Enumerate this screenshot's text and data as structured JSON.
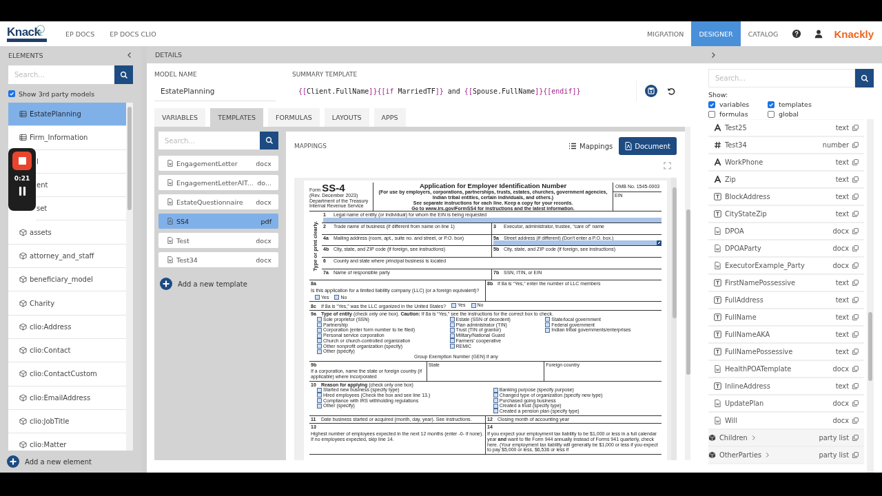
{
  "header": {
    "logo": "Knack",
    "nav_left": [
      {
        "label": "EP DOCS",
        "selected": false
      },
      {
        "label": "EP DOCS CLIO",
        "selected": false
      }
    ],
    "nav_right": [
      {
        "label": "MIGRATION",
        "selected": false
      },
      {
        "label": "DESIGNER",
        "selected": true
      },
      {
        "label": "CATALOG",
        "selected": false
      }
    ],
    "brand": "Knackly"
  },
  "elements": {
    "title": "ELEMENTS",
    "search": {
      "placeholder": "Search..."
    },
    "show_third_party": {
      "label": "Show 3rd party models",
      "checked": true
    },
    "items": [
      {
        "name": "EstatePlanning",
        "kind": "model",
        "selected": true
      },
      {
        "name": "Firm_Information",
        "kind": "model",
        "selected": false
      },
      {
        "name": "l",
        "kind": "covered",
        "selected": false
      },
      {
        "name": "ent",
        "kind": "covered",
        "selected": false
      },
      {
        "name": "set",
        "kind": "covered",
        "selected": false
      },
      {
        "name": "assets",
        "kind": "cube",
        "selected": false
      },
      {
        "name": "attorney_and_staff",
        "kind": "cube",
        "selected": false
      },
      {
        "name": "beneficiary_model",
        "kind": "cube",
        "selected": false
      },
      {
        "name": "Charity",
        "kind": "cube",
        "selected": false
      },
      {
        "name": "clio:Address",
        "kind": "cube",
        "selected": false
      },
      {
        "name": "clio:Contact",
        "kind": "cube",
        "selected": false
      },
      {
        "name": "clio:ContactCustom",
        "kind": "cube",
        "selected": false
      },
      {
        "name": "clio:EmailAddress",
        "kind": "cube",
        "selected": false
      },
      {
        "name": "clio:JobTitle",
        "kind": "cube",
        "selected": false
      },
      {
        "name": "clio:Matter",
        "kind": "cube",
        "selected": false
      }
    ],
    "add": "Add a new element"
  },
  "recorder": {
    "time": "0:21"
  },
  "details": {
    "title": "DETAILS",
    "model_name_label": "MODEL NAME",
    "model_name": "EstatePlanning",
    "summary_label": "SUMMARY TEMPLATE",
    "summary_tokens": [
      {
        "text": "{[",
        "kind": "tag"
      },
      {
        "text": "Client.FullName",
        "kind": "plain"
      },
      {
        "text": "]}{[if",
        "kind": "tag"
      },
      {
        "text": " MarriedTF",
        "kind": "plain"
      },
      {
        "text": "]}",
        "kind": "tag"
      },
      {
        "text": " and ",
        "kind": "plain"
      },
      {
        "text": "{[",
        "kind": "tag"
      },
      {
        "text": "Spouse.FullName",
        "kind": "plain"
      },
      {
        "text": "]}{[endif]}",
        "kind": "tag"
      }
    ],
    "tabs": [
      {
        "label": "VARIABLES",
        "selected": false
      },
      {
        "label": "TEMPLATES",
        "selected": true
      },
      {
        "label": "FORMULAS",
        "selected": false
      },
      {
        "label": "LAYOUTS",
        "selected": false
      },
      {
        "label": "APPS",
        "selected": false
      }
    ]
  },
  "templates": {
    "search": {
      "placeholder": "Search..."
    },
    "items": [
      {
        "name": "EngagementLetter",
        "ext": "docx",
        "kind": "docx",
        "selected": false
      },
      {
        "name": "EngagementLetterAIT...",
        "ext": "do...",
        "kind": "docx",
        "selected": false
      },
      {
        "name": "EstateQuestionnaire",
        "ext": "docx",
        "kind": "docx",
        "selected": false
      },
      {
        "name": "SS4",
        "ext": "pdf",
        "kind": "pdf",
        "selected": true
      },
      {
        "name": "Test",
        "ext": "docx",
        "kind": "docx",
        "selected": false
      },
      {
        "name": "Test34",
        "ext": "docx",
        "kind": "docx",
        "selected": false
      }
    ],
    "add": "Add a new template"
  },
  "mappings": {
    "title": "MAPPINGS",
    "views": [
      {
        "label": "Mappings",
        "kind": "list",
        "selected": false
      },
      {
        "label": "Document",
        "kind": "document",
        "selected": true
      }
    ]
  },
  "document": {
    "form_word": "Form",
    "form_number": "SS-4",
    "revision": "(Rev. December 2023)",
    "department": "Department of the Treasury",
    "service": "Internal Revenue Service",
    "title": "Application for Employer Identification Number",
    "subtitle": "(For use by employers, corporations, partnerships, trusts, estates, churches, government agencies, Indian tribal entities, certain individuals, and others.)",
    "instructions": [
      "See separate instructions for each line. Keep a copy for your records.",
      "Go to www.irs.gov/FormSS4 for instructions and the latest information."
    ],
    "omb": "OMB No. 1545-0003",
    "ein_label": "EIN",
    "side_label": "Type or print clearly.",
    "print_rows": [
      {
        "cells": [
          {
            "number": "1",
            "label": "Legal name of entity (or individual) for whom the EIN is being requested",
            "mapped": true
          }
        ]
      },
      {
        "cells": [
          {
            "number": "2",
            "label": "Trade name of business (if different from name on line 1)",
            "mapped": false
          },
          {
            "number": "3",
            "label": "Executor, administrator, trustee, “care of” name",
            "mapped": false
          }
        ]
      },
      {
        "cells": [
          {
            "number": "4a",
            "label": "Mailing address (room, apt., suite no. and street, or P.O. box)",
            "mapped": false
          },
          {
            "number": "5a",
            "label": "Street address (if different) (Don't enter a P.O. box.)",
            "mapped": true
          }
        ]
      },
      {
        "cells": [
          {
            "number": "4b",
            "label": "City, state, and ZIP code (if foreign, see instructions)",
            "mapped": false
          },
          {
            "number": "5b",
            "label": "City, state, and ZIP code (if foreign, see instructions)",
            "mapped": false
          }
        ]
      },
      {
        "cells": [
          {
            "number": "6",
            "label": "County and state where principal business is located",
            "mapped": false
          }
        ]
      },
      {
        "cells": [
          {
            "number": "7a",
            "label": "Name of responsible party",
            "mapped": false
          },
          {
            "number": "7b",
            "label": "SSN, ITIN, or EIN",
            "mapped": false
          }
        ]
      }
    ],
    "questions": [
      {
        "parts": [
          {
            "number": "8a",
            "label": "Is this application for a limited liability company (LLC) (or a foreign equivalent)?",
            "options": [
              {
                "label": "Yes",
                "checked": false
              },
              {
                "label": "No",
                "checked": false
              }
            ]
          },
          {
            "number": "8b",
            "label": "If 8a is “Yes,” enter the number of LLC members"
          }
        ]
      },
      {
        "parts": [
          {
            "number": "8c",
            "label": "If 8a is “Yes,” was the LLC organized in the United States?",
            "options": [
              {
                "label": "Yes",
                "checked": false
              },
              {
                "label": "No",
                "checked": false
              }
            ]
          }
        ]
      },
      {
        "parts": [
          {
            "number": "9a",
            "label": "**Type of entity** (check only one box). **Caution:** If 8a is “Yes,” see the instructions for the correct box to check.",
            "columns": [
              [
                {
                  "label": "Sole proprietor (SSN)",
                  "checked": false
                },
                {
                  "label": "Partnership",
                  "checked": false
                },
                {
                  "label": "Corporation (enter form number to be filed)",
                  "checked": false
                },
                {
                  "label": "Personal service corporation",
                  "checked": false
                },
                {
                  "label": "Church or church-controlled organization",
                  "checked": false
                },
                {
                  "label": "Other nonprofit organization (specify)",
                  "checked": false
                },
                {
                  "label": "Other (specify)",
                  "checked": false
                }
              ],
              [
                {
                  "label": "Estate (SSN of decedent)",
                  "checked": false
                },
                {
                  "label": "Plan administrator (TIN)",
                  "checked": false
                },
                {
                  "label": "Trust (TIN of grantor)",
                  "checked": false
                },
                {
                  "label": "Military/National Guard",
                  "checked": false
                },
                {
                  "label": "Farmers' cooperative",
                  "checked": false
                },
                {
                  "label": "REMIC",
                  "checked": false
                }
              ],
              [
                {
                  "label": "State/local government",
                  "checked": false
                },
                {
                  "label": "Federal government",
                  "checked": false
                },
                {
                  "label": "Indian tribal governments/enterprises",
                  "checked": false
                }
              ]
            ],
            "note": "Group Exemption Number (GEN) if any"
          }
        ]
      },
      {
        "parts": [
          {
            "number": "9b",
            "label": "If a corporation, name the state or foreign country (if applicable) where incorporated"
          },
          {
            "label": "State"
          },
          {
            "label": "Foreign country"
          }
        ]
      },
      {
        "parts": [
          {
            "number": "10",
            "label": "**Reason for applying** (check only one box)",
            "columns": [
              [
                {
                  "label": "Started new business (specify type)",
                  "checked": false
                },
                {
                  "label": "Hired employees (Check the box and see line 13.)",
                  "checked": false
                },
                {
                  "label": "Compliance with IRS withholding regulations",
                  "checked": false
                },
                {
                  "label": "Other (specify)",
                  "checked": false
                }
              ],
              [
                {
                  "label": "Banking purpose (specify purpose)",
                  "checked": false
                },
                {
                  "label": "Changed type of organization (specify new type)",
                  "checked": false
                },
                {
                  "label": "Purchased going business",
                  "checked": false
                },
                {
                  "label": "Created a trust (specify type)",
                  "checked": false
                },
                {
                  "label": "Created a pension plan (specify type)",
                  "checked": false
                }
              ]
            ]
          }
        ]
      },
      {
        "parts": [
          {
            "number": "11",
            "label": "Date business started or acquired (month, day, year). See instructions."
          },
          {
            "number": "12",
            "label": "Closing month of accounting year"
          }
        ]
      },
      {
        "parts": [
          {
            "number": "13",
            "label": "Highest number of employees expected in the next 12 months (enter -0- if none). If no employees expected, skip line 14."
          },
          {
            "number": "14",
            "label": "If you expect your employment tax liability to be $1,000 or less in a full calendar year **and** want to file Form 944 annually instead of Forms 941 quarterly, check here. (Your employment tax liability will generally be $1,000 or less if you expect to pay $5,000 or less, $6,536 or less if"
          }
        ]
      }
    ]
  },
  "library": {
    "search": {
      "placeholder": "Search..."
    },
    "show_label": "Show:",
    "filters": [
      {
        "label": "variables",
        "checked": true
      },
      {
        "label": "templates",
        "checked": true
      },
      {
        "label": "formulas",
        "checked": false
      },
      {
        "label": "global",
        "checked": false
      }
    ],
    "items": [
      {
        "name": "Test25",
        "type": "text",
        "kind": "text"
      },
      {
        "name": "Test34",
        "type": "number",
        "kind": "number"
      },
      {
        "name": "WorkPhone",
        "type": "text",
        "kind": "text"
      },
      {
        "name": "Zip",
        "type": "text",
        "kind": "text"
      },
      {
        "name": "BlockAddress",
        "type": "text",
        "kind": "formula"
      },
      {
        "name": "CityStateZip",
        "type": "text",
        "kind": "formula"
      },
      {
        "name": "DPOA",
        "type": "docx",
        "kind": "docx"
      },
      {
        "name": "DPOAParty",
        "type": "docx",
        "kind": "docx"
      },
      {
        "name": "ExecutorExample_Party",
        "type": "docx",
        "kind": "docx"
      },
      {
        "name": "FirstNamePossessive",
        "type": "text",
        "kind": "formula"
      },
      {
        "name": "FullAddress",
        "type": "text",
        "kind": "formula"
      },
      {
        "name": "FullName",
        "type": "text",
        "kind": "formula"
      },
      {
        "name": "FullNameAKA",
        "type": "text",
        "kind": "formula"
      },
      {
        "name": "FullNamePossessive",
        "type": "text",
        "kind": "formula"
      },
      {
        "name": "HealthPOATemplate",
        "type": "docx",
        "kind": "docx"
      },
      {
        "name": "InlineAddress",
        "type": "text",
        "kind": "formula"
      },
      {
        "name": "UpdatePlan",
        "type": "docx",
        "kind": "docx"
      },
      {
        "name": "Will",
        "type": "docx",
        "kind": "docx"
      },
      {
        "name": "Children",
        "type": "party list",
        "kind": "party"
      },
      {
        "name": "OtherParties",
        "type": "party list",
        "kind": "party"
      }
    ]
  }
}
